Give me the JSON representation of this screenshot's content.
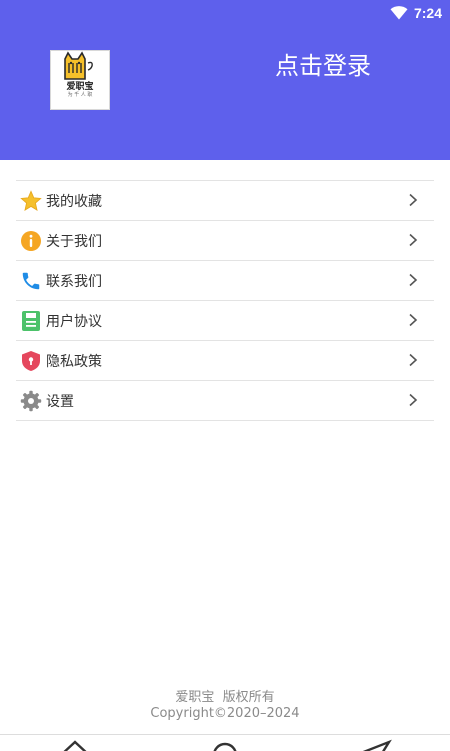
{
  "status_bar": {
    "time": "7:24",
    "wifi_icon": "wifi-icon"
  },
  "header": {
    "logo": {
      "name": "爱职宝",
      "slogan": "为 千 人 职"
    },
    "login_text": "点击登录",
    "background_color": "#5e60ec"
  },
  "menu": {
    "items": [
      {
        "label": "我的收藏",
        "icon": "star-icon",
        "icon_color": "#f5c02c"
      },
      {
        "label": "关于我们",
        "icon": "info-icon",
        "icon_color": "#f5a623"
      },
      {
        "label": "联系我们",
        "icon": "phone-icon",
        "icon_color": "#1f8ce6"
      },
      {
        "label": "用户协议",
        "icon": "document-icon",
        "icon_color": "#4cc26a"
      },
      {
        "label": "隐私政策",
        "icon": "shield-icon",
        "icon_color": "#e5475d"
      },
      {
        "label": "设置",
        "icon": "gear-icon",
        "icon_color": "#8a8a8a"
      }
    ]
  },
  "footer": {
    "line1": "爱职宝  版权所有",
    "line2": "Copyright©2020–2024"
  },
  "nav_bar": {
    "buttons": [
      "home-icon",
      "search-icon",
      "send-icon"
    ]
  }
}
